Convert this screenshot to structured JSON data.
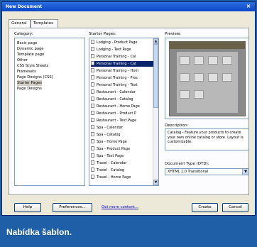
{
  "window": {
    "title": "New Document",
    "close_glyph": "×"
  },
  "tabs": [
    {
      "label": "General"
    },
    {
      "label": "Templates"
    }
  ],
  "labels": {
    "category": "Category:",
    "starter_pages": "Starter Pages:",
    "preview": "Preview:",
    "description": "Description:",
    "doctype": "Document Type (DTD):"
  },
  "categories": [
    "Basic page",
    "Dynamic page",
    "Template page",
    "Other",
    "CSS Style Sheets",
    "Framesets",
    "Page Designs (CSS)",
    "Starter Pages",
    "Page Designs"
  ],
  "selected_category": "Starter Pages",
  "starter_pages": [
    "Lodging - Product Page",
    "Lodging - Text Page",
    "Personal Training - Cal",
    "Personal Training - Cat",
    "Personal Training - Hom",
    "Personal Training - Proc",
    "Personal Training - Text",
    "Restaurant - Calendar",
    "Restaurant - Catalog",
    "Restaurant - Home Page",
    "Restaurant - Product P",
    "Restaurant - Text Page",
    "Spa - Calendar",
    "Spa - Catalog",
    "Spa - Home Page",
    "Spa - Product Page",
    "Spa - Text Page",
    "Travel - Calendar",
    "Travel - Catalog",
    "Travel - Home Page"
  ],
  "selected_page": "Personal Training - Cat",
  "description": "Catalog - Feature your products to create your own online catalog or store. Layout is customizable.",
  "doctype": {
    "value": "XHTML 1.0 Transitional"
  },
  "buttons": {
    "help": "Help",
    "preferences": "Preferences...",
    "get_more": "Get more content...",
    "create": "Create",
    "cancel": "Cancel"
  },
  "caption": "Nabídka šablon.",
  "colors": {
    "caption_bg": "#1e5fa8",
    "selection": "#0a246a",
    "titlebar": "#0a46c8"
  }
}
